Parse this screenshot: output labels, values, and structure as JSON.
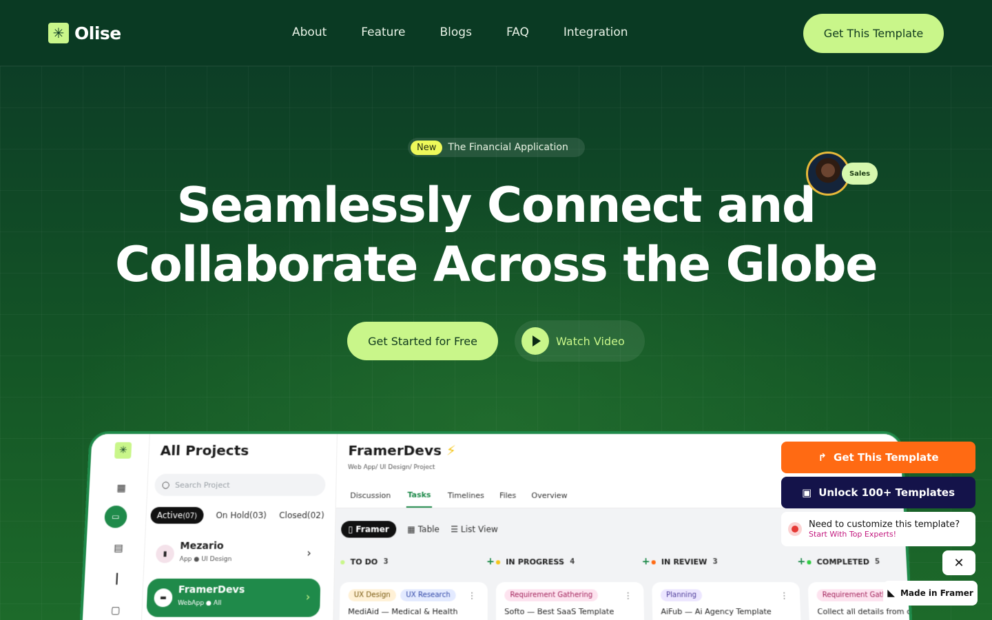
{
  "brand": {
    "name": "Olise",
    "logo_icon": "asterisk-logo-icon"
  },
  "nav": {
    "links": [
      "About",
      "Feature",
      "Blogs",
      "FAQ",
      "Integration"
    ],
    "cta": "Get This Template"
  },
  "hero": {
    "badge_new": "New",
    "badge_text": "The Financial Application",
    "title_line1": "Seamlessly Connect and",
    "title_line2": "Collaborate Across the Globe",
    "avatar_tag": "Sales",
    "primary_cta": "Get Started for Free",
    "video_cta": "Watch Video"
  },
  "dashboard": {
    "projects_title": "All Projects",
    "search_placeholder": "Search Project",
    "filters": {
      "active": "Active",
      "active_count": "(07)",
      "on_hold": "On Hold(03)",
      "closed": "Closed(02)"
    },
    "projects": [
      {
        "name": "Mezario",
        "meta": "App  ●  UI Design"
      },
      {
        "name": "FramerDevs",
        "meta": "WebApp  ●  All"
      }
    ],
    "main_title": "FramerDevs",
    "main_title_icon": "⚡",
    "breadcrumb": "Web App/ UI Design/ Project",
    "tabs": [
      "Discussion",
      "Tasks",
      "Timelines",
      "Files",
      "Overview"
    ],
    "active_tab": "Tasks",
    "views": [
      "Framer",
      "Table",
      "List View"
    ],
    "columns": [
      {
        "name": "TO DO",
        "count": "3",
        "color": "#c9f68a",
        "tags": [
          "UX Design",
          "UX Research"
        ],
        "tag_colors": [
          "#fff1d6",
          "#e3eaff"
        ],
        "card_title": "MediAid — Medical & Health"
      },
      {
        "name": "IN PROGRESS",
        "count": "4",
        "color": "#f5c518",
        "tags": [
          "Requirement Gathering"
        ],
        "tag_colors": [
          "#fde3ef"
        ],
        "card_title": "Softo — Best SaaS Template"
      },
      {
        "name": "IN REVIEW",
        "count": "3",
        "color": "#ff6a13",
        "tags": [
          "Planning"
        ],
        "tag_colors": [
          "#ece6ff"
        ],
        "card_title": "AiFub — Ai Agency Template"
      },
      {
        "name": "COMPLETED",
        "count": "5",
        "color": "#2ecc40",
        "tags": [
          "Requirement Gath"
        ],
        "tag_colors": [
          "#fde3ef"
        ],
        "card_title": "Collect all details from c"
      }
    ]
  },
  "overlay": {
    "get_template": "Get This Template",
    "unlock": "Unlock 100+ Templates",
    "help_line1": "Need to customize this template?",
    "help_line2": "Start With Top Experts!",
    "made_in": "Made in Framer"
  },
  "colors": {
    "accent": "#c9f68a",
    "bg_dark": "#0a3a23",
    "brand_green": "#1f8a4a",
    "orange": "#ff6a13",
    "navy": "#14134a"
  }
}
